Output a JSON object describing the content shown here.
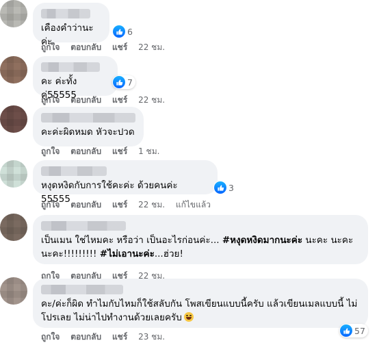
{
  "actions": {
    "like": "ถูกใจ",
    "reply": "ตอบกลับ",
    "share": "แชร์"
  },
  "comments": [
    {
      "text": "เคืองคำว่านะค่ะ",
      "reactions": "6",
      "time": "22 ชม."
    },
    {
      "text": "คะ ค่ะทั้งคู่55555",
      "reactions": "7",
      "time": "22 ชม."
    },
    {
      "text": "คะค่ะผิดหมด หัวจะปวด",
      "time": "1 ชม."
    },
    {
      "text": "หงุดหงิดกับการใช้คะค่ะ ด้วยคนค่ะ 55555",
      "reactions": "3",
      "time": "22 ชม.",
      "edited": "แก้ไขแล้ว"
    },
    {
      "text_a": "เป็นเมน ใช่ไหมคะ หรือว่า เป็นอะไรก่อนค่ะ... ",
      "tag_a": "#หงุดหงิดมากนะค่ะ",
      "text_b": " นะคะ นะคะ นะคะ!!!!!!!!! ",
      "tag_b": "#ไม่เอานะค่ะ",
      "text_c": "...ฮ่วย!",
      "time": "22 ชม."
    },
    {
      "text": "คะ/ค่ะก็ผิด ทำไมกับไหมก็ใช้สลับกัน โพสเขียนแบบนี้ครับ แล้วเขียนเมลแบบนี้ ไม่โปรเลย ไม่น่าไปทำงานด้วยเลยครับ",
      "reactions": "57",
      "time": "23 ชม."
    }
  ],
  "colors": {
    "bubble": "#f0f2f5",
    "like": "#0866ff",
    "meta": "#65676b"
  }
}
